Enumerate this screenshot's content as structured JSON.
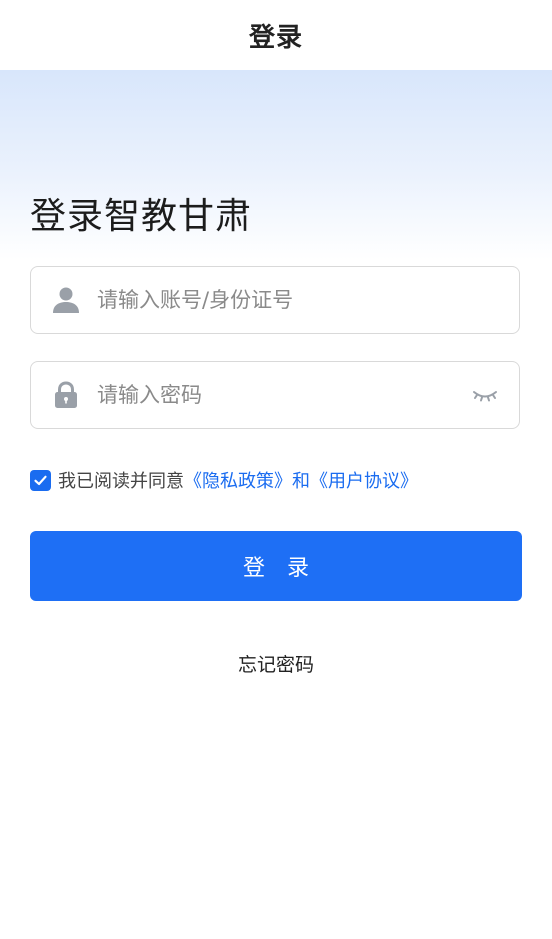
{
  "nav": {
    "title": "登录"
  },
  "hero": {
    "title": "登录智教甘肃"
  },
  "account_field": {
    "placeholder": "请输入账号/身份证号",
    "value": "",
    "icon": "user-icon"
  },
  "password_field": {
    "placeholder": "请输入密码",
    "value": "",
    "icon": "lock-icon",
    "toggle_icon": "eye-closed-icon"
  },
  "agreement": {
    "checked": true,
    "prefix": "我已阅读并同意",
    "privacy_link": "《隐私政策》",
    "joiner": "和",
    "user_agreement_link": "《用户协议》"
  },
  "login_button": {
    "label": "登录"
  },
  "forgot_password": {
    "label": "忘记密码"
  },
  "colors": {
    "accent": "#1e6ff5",
    "link": "#1a6cf0",
    "icon_gray": "#9aa0a8",
    "hero_gradient_top": "#d8e6fb"
  }
}
